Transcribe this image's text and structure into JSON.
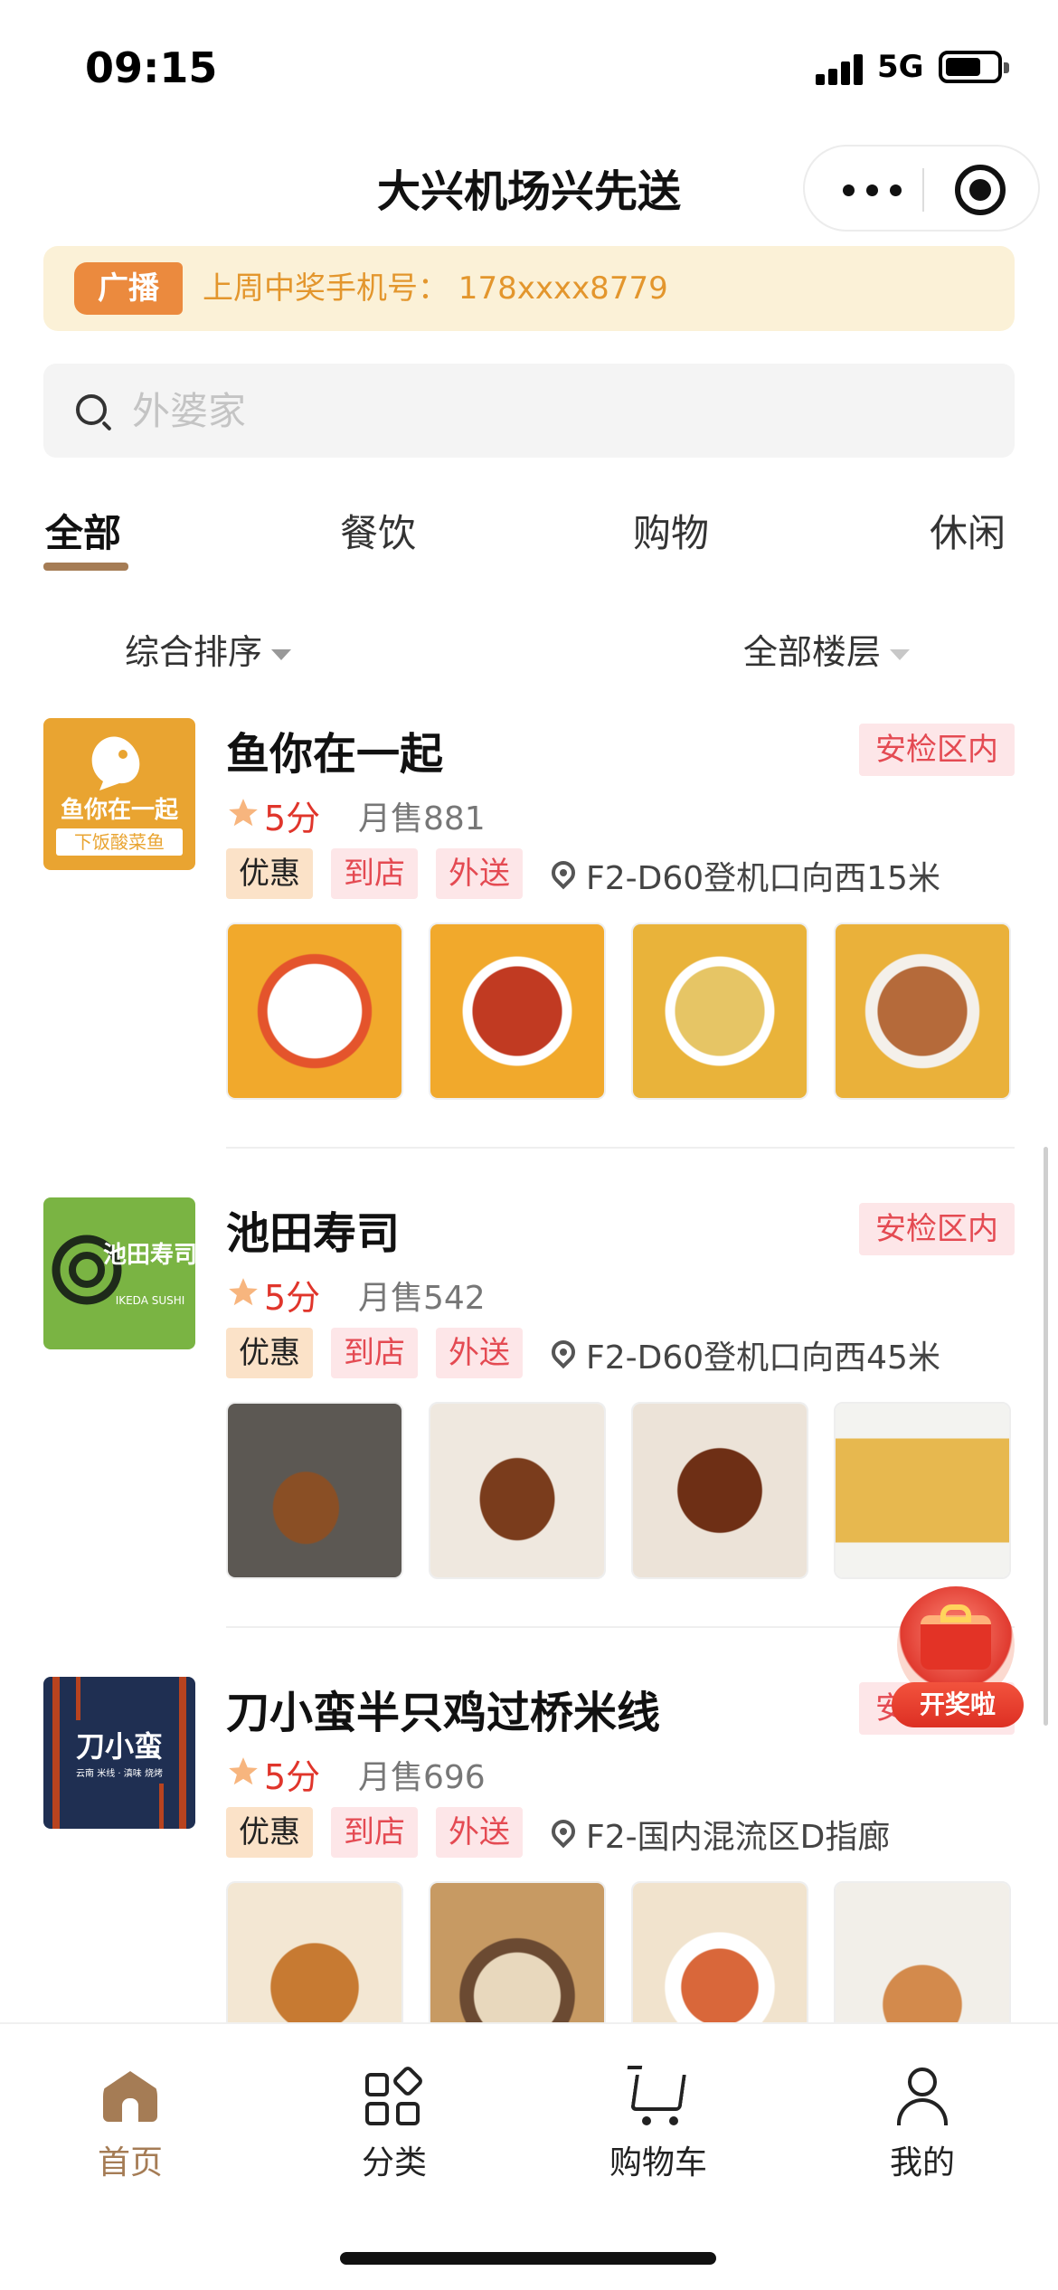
{
  "status_bar": {
    "time": "09:15",
    "network": "5G"
  },
  "nav": {
    "title": "大兴机场兴先送"
  },
  "notice": {
    "tag": "广播",
    "text": "上周中奖手机号： 178xxxx8779"
  },
  "search": {
    "placeholder": "外婆家",
    "value": ""
  },
  "tabs": [
    {
      "label": "全部",
      "active": true
    },
    {
      "label": "餐饮",
      "active": false
    },
    {
      "label": "购物",
      "active": false
    },
    {
      "label": "休闲",
      "active": false
    }
  ],
  "filters": {
    "sort": "综合排序",
    "floor": "全部楼层"
  },
  "stores": [
    {
      "name": "鱼你在一起",
      "logo_text": "鱼你在一起",
      "logo_subtext": "下饭酸菜鱼",
      "logo_color": "#e9a431",
      "zone": "安检区内",
      "rating": "5分",
      "monthly_sales": "月售881",
      "tags": [
        "优惠",
        "到店",
        "外送"
      ],
      "location": "F2-D60登机口向西15米",
      "photo_colors": [
        "#f1a92c",
        "#d95a2c",
        "#e9b33a",
        "#eab13a"
      ]
    },
    {
      "name": "池田寿司",
      "logo_text": "池田寿司",
      "logo_subtext": "IKEDA SUSHI",
      "logo_color": "#7ab443",
      "zone": "安检区内",
      "rating": "5分",
      "monthly_sales": "月售542",
      "tags": [
        "优惠",
        "到店",
        "外送"
      ],
      "location": "F2-D60登机口向西45米",
      "photo_colors": [
        "#5e5a55",
        "#8d6a4c",
        "#7a4a2a",
        "#e7b84f"
      ]
    },
    {
      "name": "刀小蛮半只鸡过桥米线",
      "logo_text": "刀小蛮",
      "logo_subtext": "云南 米线 · 滇味 烧烤",
      "logo_color": "#1f2f52",
      "zone": "安检区内",
      "rating": "5分",
      "monthly_sales": "月售696",
      "tags": [
        "优惠",
        "到店",
        "外送"
      ],
      "location": "F2-国内混流区D指廊",
      "photo_colors": [
        "#d79a52",
        "#b58a5a",
        "#e6c793",
        "#d9d4cc"
      ]
    }
  ],
  "prize": {
    "label": "开奖啦"
  },
  "tabbar": [
    {
      "label": "首页",
      "icon": "home-icon",
      "active": true
    },
    {
      "label": "分类",
      "icon": "category-icon",
      "active": false
    },
    {
      "label": "购物车",
      "icon": "cart-icon",
      "active": false
    },
    {
      "label": "我的",
      "icon": "user-icon",
      "active": false
    }
  ],
  "colors": {
    "accent": "#a57c55",
    "price_red": "#e0352b",
    "notice_bg": "#fbf1d7",
    "notice_text": "#e3962d"
  }
}
